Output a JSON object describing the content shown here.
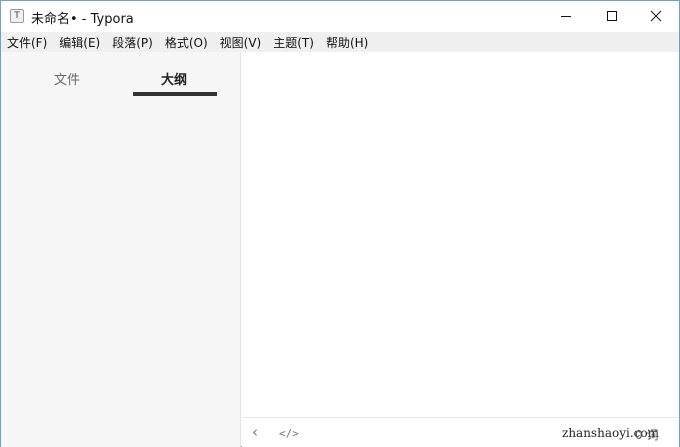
{
  "window": {
    "title": "未命名• - Typora",
    "app_icon_glyph": "T"
  },
  "menu": {
    "items": [
      {
        "label": "文件(F)"
      },
      {
        "label": "编辑(E)"
      },
      {
        "label": "段落(P)"
      },
      {
        "label": "格式(O)"
      },
      {
        "label": "视图(V)"
      },
      {
        "label": "主题(T)"
      },
      {
        "label": "帮助(H)"
      }
    ]
  },
  "sidebar": {
    "tabs": [
      {
        "label": "文件",
        "active": false
      },
      {
        "label": "大纲",
        "active": true
      }
    ]
  },
  "footer": {
    "back_icon": "‹",
    "code_icon": "</>",
    "watermark": "zhanshaoyi.com",
    "word_count": "0 词"
  },
  "colors": {
    "window_border": "#6aa0d8",
    "menubar_bg": "#f0f0f0",
    "sidebar_bg": "#f7f7f7",
    "active_tab_underline": "#333333"
  }
}
